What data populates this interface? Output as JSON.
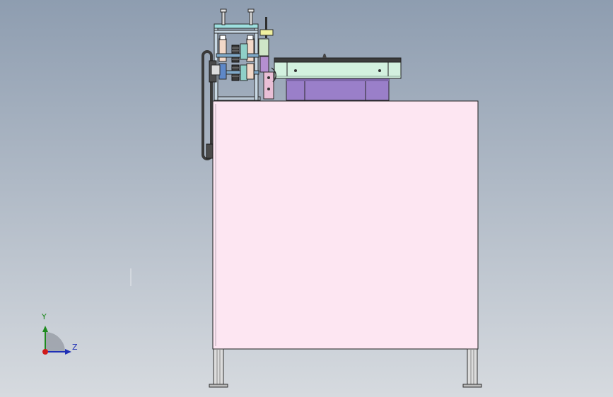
{
  "viewport": {
    "background_top": "#8e9db0",
    "background_bottom": "#d6dadf"
  },
  "model": {
    "cabinet_color": "#fde6f2",
    "cover_color": "#d3f1df",
    "motor_color": "#9a7fc9",
    "outline_color": "#202020"
  },
  "triad": {
    "y_label": "Y",
    "z_label": "Z",
    "y_color": "#1e8a1e",
    "z_color": "#1f2fb5",
    "origin_color": "#d01a1a"
  }
}
